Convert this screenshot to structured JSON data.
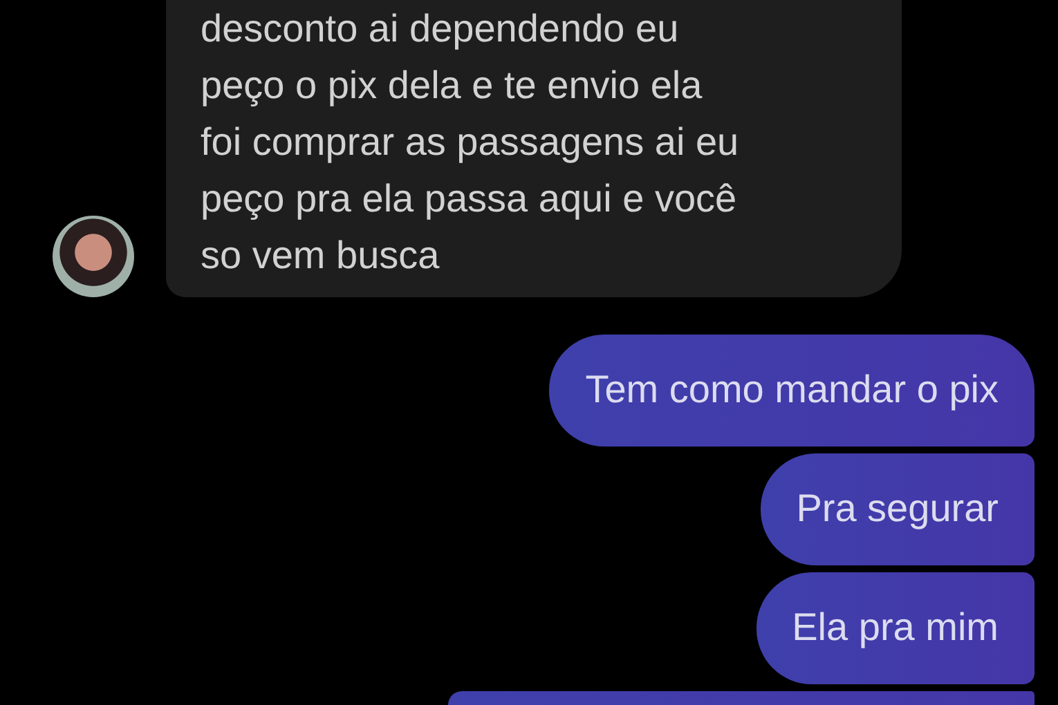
{
  "messages": [
    {
      "kind": "received",
      "text": "desconto ai dependendo eu\npeço o pix dela e te envio ela\nfoi comprar as passagens ai eu\npeço pra ela passa aqui e você\nso vem busca",
      "avatar": true
    },
    {
      "kind": "sent",
      "text": "Tem como mandar o pix"
    },
    {
      "kind": "sent",
      "text": "Pra segurar"
    },
    {
      "kind": "sent",
      "text": "Ela pra mim"
    },
    {
      "kind": "sent"
    }
  ]
}
